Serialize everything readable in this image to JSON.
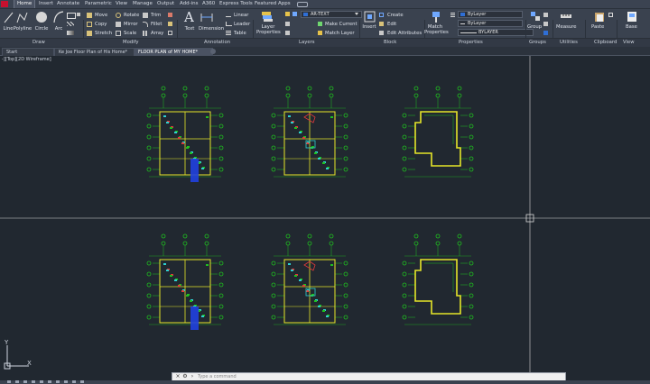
{
  "ribbon_tabs": [
    "Home",
    "Insert",
    "Annotate",
    "Parametric",
    "View",
    "Manage",
    "Output",
    "Add-ins",
    "A360",
    "Express Tools",
    "Featured Apps"
  ],
  "draw": {
    "line": "Line",
    "polyline": "Polyline",
    "circle": "Circle",
    "arc": "Arc"
  },
  "modify": {
    "move": "Move",
    "rotate": "Rotate",
    "trim": "Trim",
    "copy": "Copy",
    "mirror": "Mirror",
    "fillet": "Fillet",
    "stretch": "Stretch",
    "scale": "Scale",
    "array": "Array"
  },
  "annotation": {
    "text": "Text",
    "dimension": "Dimension",
    "linear": "Linear",
    "leader": "Leader",
    "table": "Table"
  },
  "layers": {
    "layer_properties": "Layer Properties",
    "current_layer": "AR-TEXT",
    "make_current": "Make Current",
    "match_layer": "Match Layer"
  },
  "block": {
    "insert": "Insert",
    "create": "Create",
    "edit": "Edit",
    "edit_attributes": "Edit Attributes"
  },
  "properties": {
    "match_properties": "Match Properties",
    "color": "ByLayer",
    "linetype": "ByLayer",
    "lineweight": "BYLAYER"
  },
  "groups": {
    "group": "Group"
  },
  "utilities": {
    "measure": "Measure"
  },
  "clipboard": {
    "paste": "Paste"
  },
  "view": {
    "base": "Base"
  },
  "panel_labels": {
    "draw": "Draw",
    "modify": "Modify",
    "annotation": "Annotation",
    "layers": "Layers",
    "block": "Block",
    "properties": "Properties",
    "groups": "Groups",
    "utilities": "Utilities",
    "clipboard": "Clipboard",
    "view": "View"
  },
  "doc_tabs": [
    "Start",
    "Ke Joe Floor Plan of His Home*",
    "FLOOR PLAN of MY HOME*"
  ],
  "viewport_label": "-][Top][2D Wireframe]",
  "ucs": {
    "x": "X",
    "y": "Y"
  },
  "command_prompt": "Type a command",
  "colors": {
    "background": "#212830",
    "ribbon": "#3a424f",
    "grid": "#1fc01f",
    "walls": "#e6e628",
    "accent": "#2f6fd6",
    "crosshair": "#d8d8d8"
  }
}
